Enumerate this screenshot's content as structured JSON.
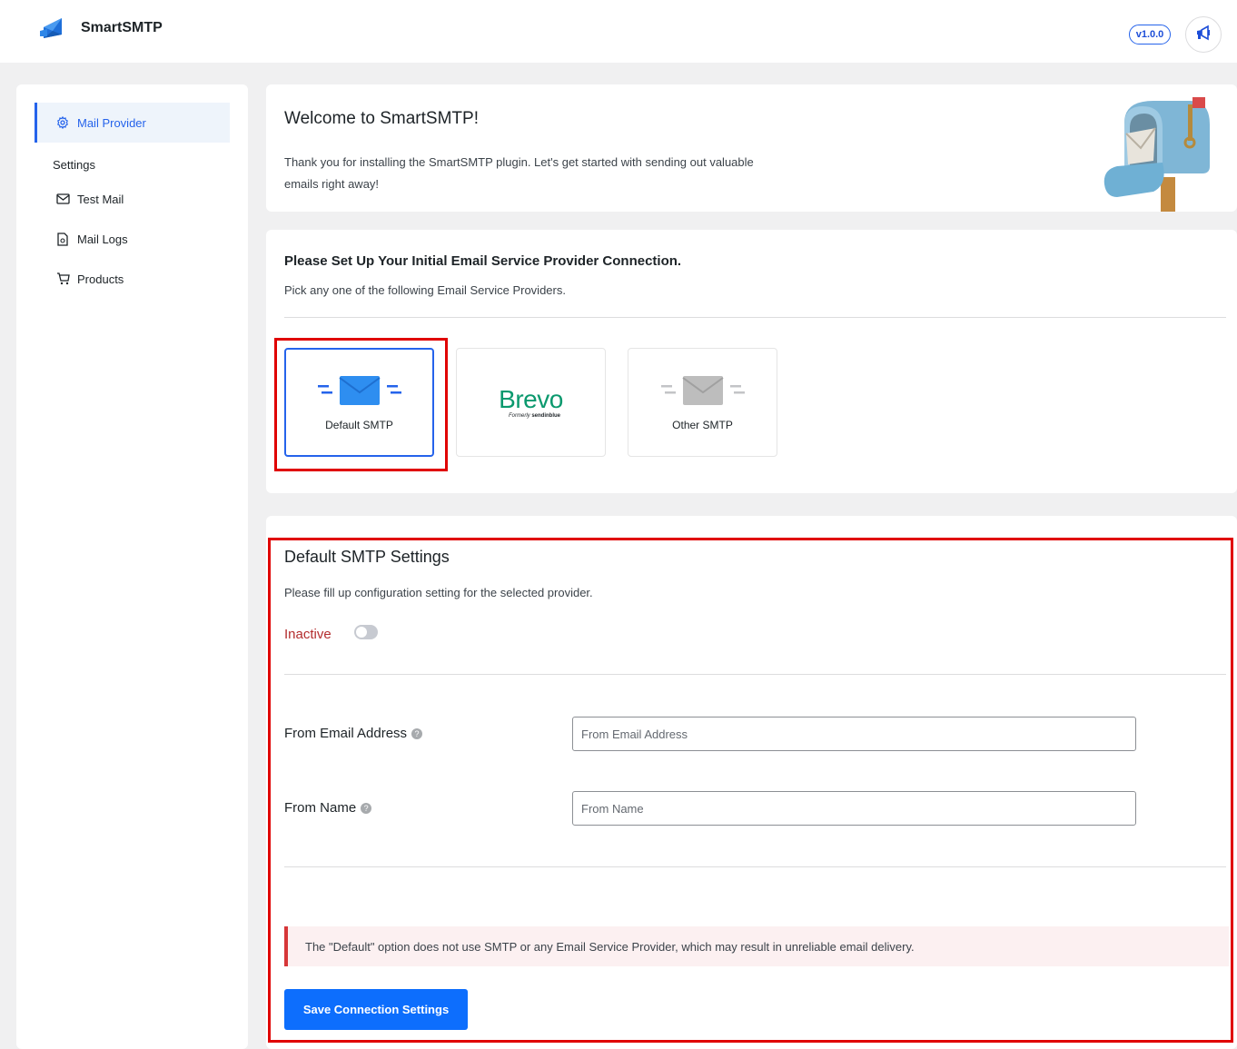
{
  "header": {
    "brand": "SmartSMTP",
    "version": "v1.0.0",
    "logo_icon": "smartsmtp-logo-icon",
    "announce_icon": "megaphone-icon"
  },
  "sidebar": {
    "active_item": {
      "label": "Mail Provider",
      "icon": "gear-icon"
    },
    "section_label": "Settings",
    "items": [
      {
        "label": "Test Mail",
        "icon": "envelope-icon"
      },
      {
        "label": "Mail Logs",
        "icon": "file-icon"
      },
      {
        "label": "Products",
        "icon": "cart-icon"
      }
    ]
  },
  "welcome": {
    "title": "Welcome to SmartSMTP!",
    "text": "Thank you for installing the SmartSMTP plugin. Let's get started with sending out valuable emails right away!"
  },
  "setup": {
    "title": "Please Set Up Your Initial Email Service Provider Connection.",
    "subtitle": "Pick any one of the following Email Service Providers.",
    "providers": [
      {
        "label": "Default SMTP",
        "selected": true
      },
      {
        "brand": "Brevo",
        "tagline_prefix": "Formerly",
        "tagline_brand": "sendinblue",
        "selected": false
      },
      {
        "label": "Other SMTP",
        "selected": false
      }
    ]
  },
  "settings": {
    "title": "Default SMTP Settings",
    "subtitle": "Please fill up configuration setting for the selected provider.",
    "status_label": "Inactive",
    "toggle_on": false,
    "fields": [
      {
        "label": "From Email Address",
        "placeholder": "From Email Address",
        "value": ""
      },
      {
        "label": "From Name",
        "placeholder": "From Name",
        "value": ""
      }
    ],
    "help_glyph": "?",
    "notice": "The \"Default\" option does not use SMTP or any Email Service Provider, which may result in unreliable email delivery.",
    "save_label": "Save Connection Settings"
  },
  "colors": {
    "accent": "#2563eb",
    "button": "#0d6efd",
    "inactive": "#b32d2e",
    "brevo": "#0b996e",
    "highlight": "#e00000"
  }
}
